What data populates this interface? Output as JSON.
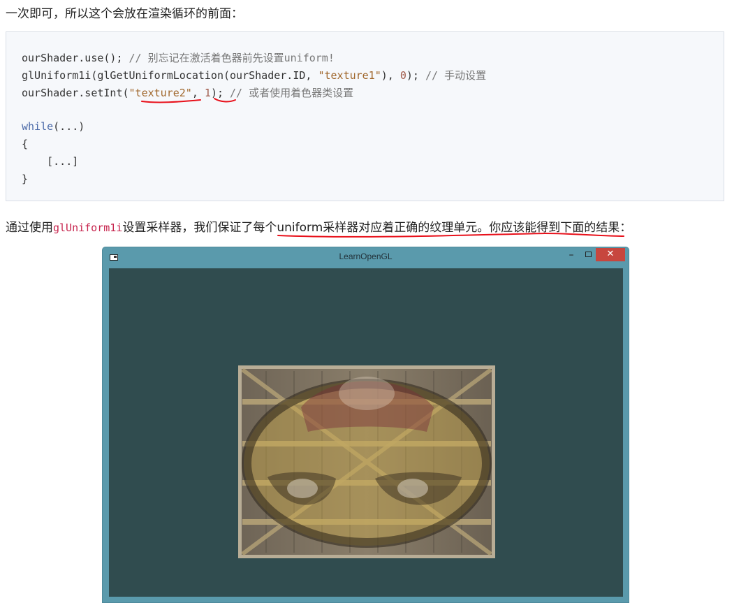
{
  "intro_text": "一次即可，所以这个会放在渲染循环的前面：",
  "code": {
    "line1_code": "ourShader.use(); ",
    "line1_comment": "// 别忘记在激活着色器前先设置uniform!",
    "line2_a": "glUniform1i(glGetUniformLocation(ourShader.ID, ",
    "line2_str": "\"texture1\"",
    "line2_b": "), ",
    "line2_num": "0",
    "line2_c": "); ",
    "line2_comment": "// 手动设置",
    "line3_a": "ourShader.setInt(",
    "line3_str": "\"texture2\"",
    "line3_b": ", ",
    "line3_num": "1",
    "line3_c": "); ",
    "line3_comment": "// 或者使用着色器类设置",
    "line5_kw": "while",
    "line5_rest": "(...)",
    "line6": "{",
    "line7": "    [...]",
    "line8": "}"
  },
  "body_text": {
    "before": "通过使用",
    "inline_code": "glUniform1i",
    "middle": "设置采样器，我们保证了",
    "underlined": "每个uniform采样器对应着正确的纹理单元。你应该能得到",
    "after": "下面的结果："
  },
  "window": {
    "title": "LearnOpenGL",
    "minimize_glyph": "–",
    "close_glyph": "✕",
    "app_icon": "app-window-icon",
    "background_color": "#304c4f",
    "titlebar_color": "#5a9aac",
    "close_color": "#c7463e"
  },
  "annotation_color": "#e8101a"
}
